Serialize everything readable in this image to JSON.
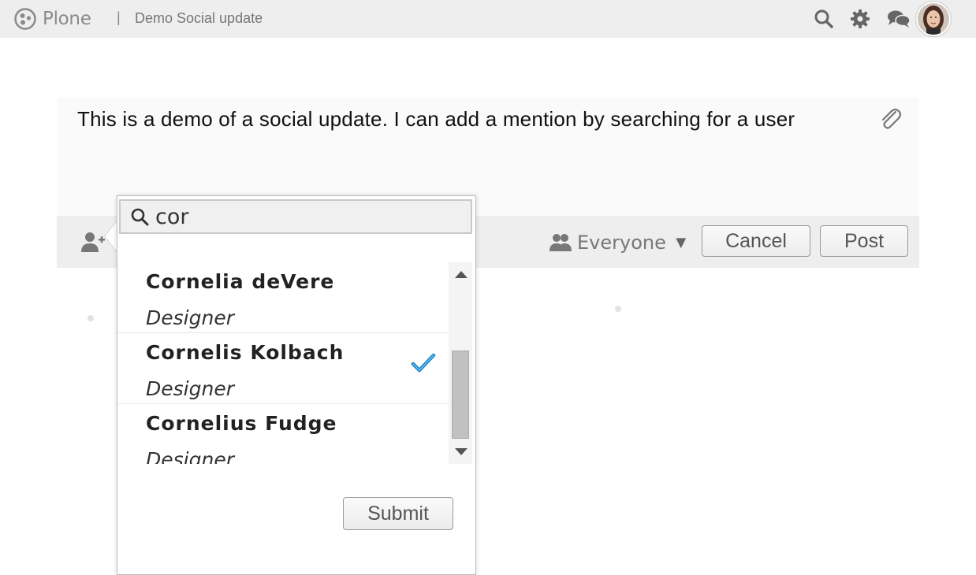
{
  "header": {
    "brand": "Plone",
    "separator": "|",
    "title": "Demo Social update",
    "icons": [
      "search-icon",
      "gear-icon",
      "chat-icon"
    ],
    "avatar": "user-avatar"
  },
  "composer": {
    "text": "This is a demo of a social update. I can add a mention by searching for a user",
    "attach_icon": "paperclip-icon"
  },
  "toolbar": {
    "add_user_icon": "add-user-icon",
    "audience_label": "Everyone",
    "audience_caret": "▼",
    "cancel_label": "Cancel",
    "post_label": "Post"
  },
  "mention_popup": {
    "search_value": "cor",
    "results": [
      {
        "name": "Cornelia deVere",
        "role": "Designer",
        "selected": false
      },
      {
        "name": "Cornelis Kolbach",
        "role": "Designer",
        "selected": true
      },
      {
        "name": "Cornelius Fudge",
        "role": "Designer",
        "selected": false
      }
    ],
    "submit_label": "Submit"
  },
  "colors": {
    "topbar_bg": "#eeeeee",
    "toolbar_bg": "#eeeeee",
    "check": "#1a86c8"
  }
}
